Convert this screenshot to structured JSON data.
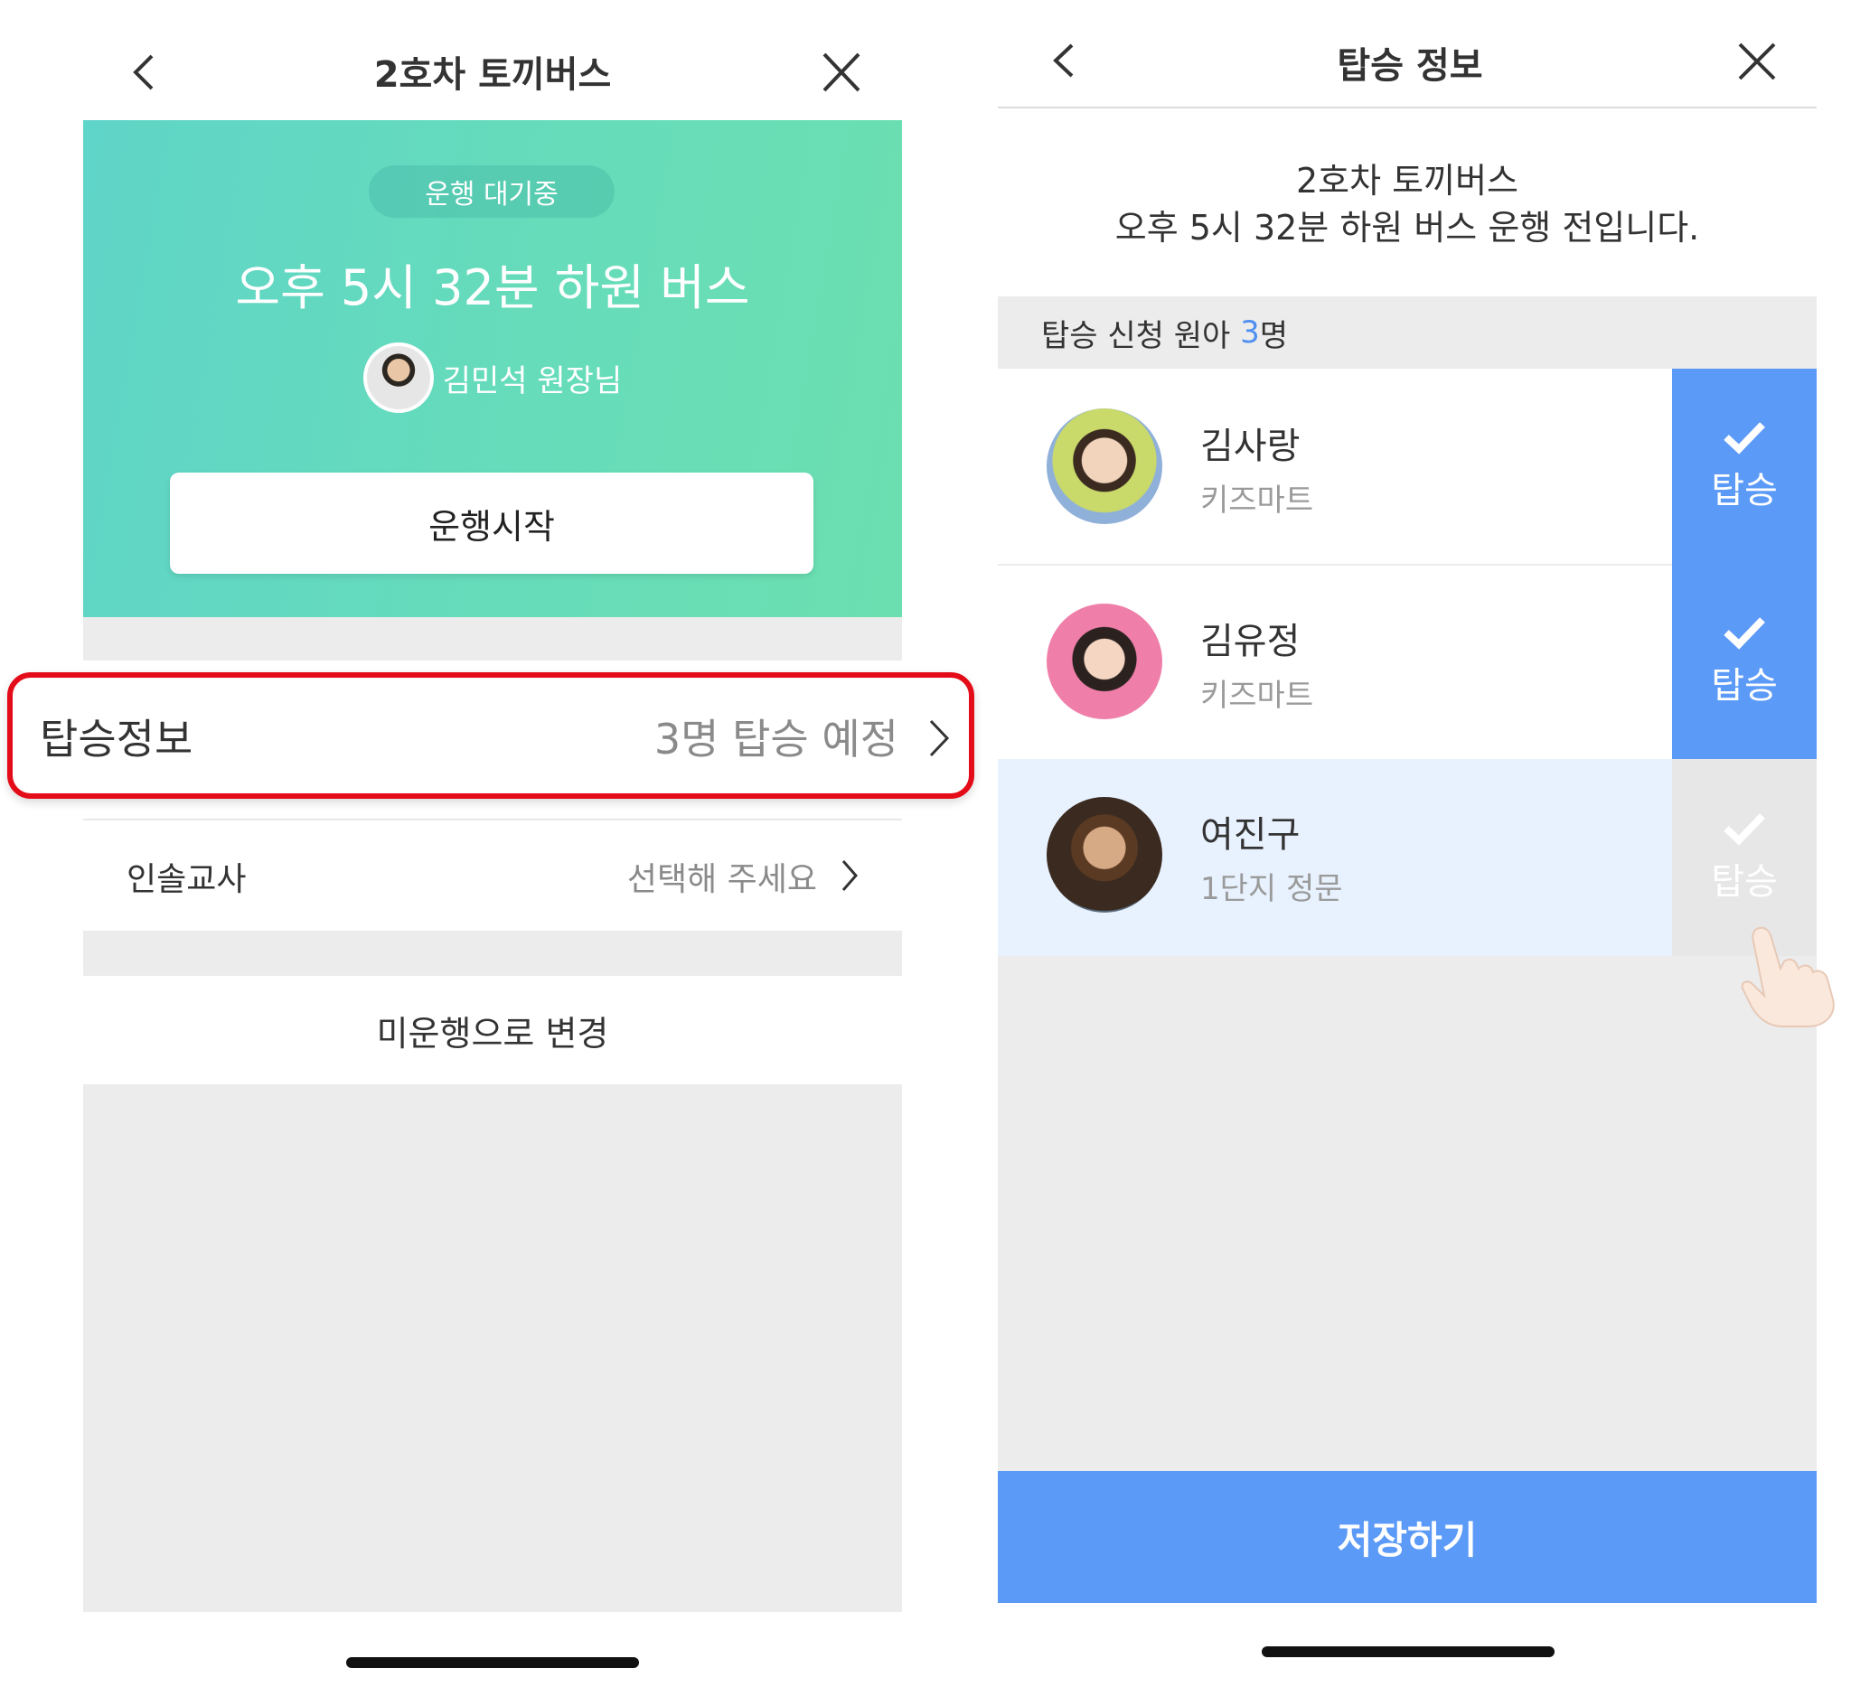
{
  "left_screen": {
    "header_title": "2호차 토끼버스",
    "status_badge": "운행 대기중",
    "trip_title": "오후 5시 32분 하원 버스",
    "driver_name": "김민석 원장님",
    "start_button": "운행시작",
    "boarding": {
      "label": "탑승정보",
      "value": "3명 탑승 예정"
    },
    "teacher": {
      "label": "인솔교사",
      "value": "선택해 주세요"
    },
    "change_button": "미운행으로 변경"
  },
  "right_screen": {
    "header_title": "탑승 정보",
    "info_line1": "2호차 토끼버스",
    "info_line2": "오후 5시 32분 하원 버스 운행 전입니다.",
    "count_label": "탑승 신청 원아 ",
    "count_number": "3",
    "count_unit": "명",
    "children": [
      {
        "name": "김사랑",
        "location": "키즈마트",
        "board_label": "탑승",
        "boarded": true
      },
      {
        "name": "김유정",
        "location": "키즈마트",
        "board_label": "탑승",
        "boarded": true
      },
      {
        "name": "여진구",
        "location": "1단지 정문",
        "board_label": "탑승",
        "boarded": false
      }
    ],
    "save_button": "저장하기"
  },
  "colors": {
    "hero_gradient_start": "#5fd4c8",
    "hero_gradient_end": "#6cdfb0",
    "accent_blue": "#5b9af7",
    "highlight_red": "#e30c18",
    "selected_row_bg": "#e8f2fe"
  },
  "icons": [
    "back-icon",
    "close-icon",
    "chevron-right-icon",
    "check-icon",
    "pointing-hand-icon"
  ]
}
